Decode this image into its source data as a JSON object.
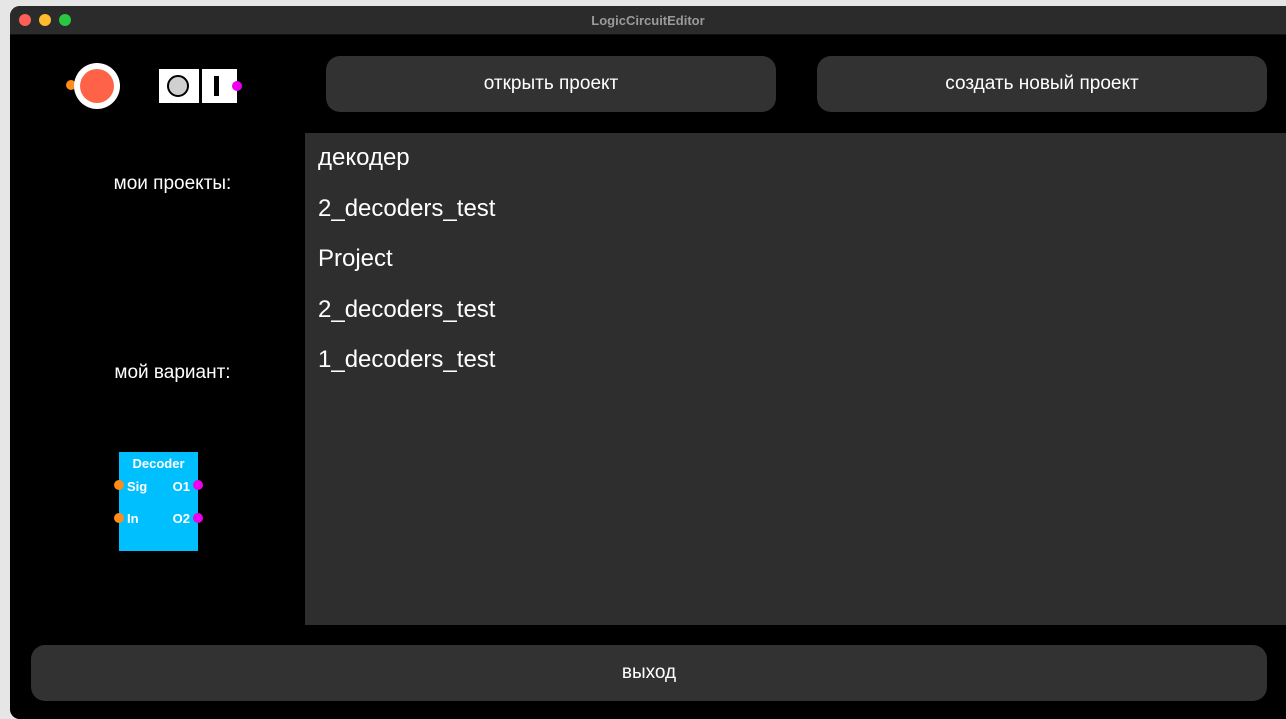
{
  "window": {
    "title": "LogicCircuitEditor"
  },
  "buttons": {
    "open_project": "открыть проект",
    "new_project": "создать новый проект",
    "exit": "выход"
  },
  "labels": {
    "my_projects": "мои проекты:",
    "my_variant": "мой вариант:"
  },
  "decoder": {
    "title": "Decoder",
    "inputs": [
      "Sig",
      "In"
    ],
    "outputs": [
      "O1",
      "O2"
    ]
  },
  "projects": [
    "декодер",
    "2_decoders_test",
    "Project",
    "2_decoders_test",
    "1_decoders_test"
  ],
  "colors": {
    "lamp_red": "#ff6347",
    "input_pin": "#ff8c1a",
    "output_pin": "#ee00ee",
    "decoder_body": "#00bfff",
    "button_bg": "#323232",
    "list_bg": "#2e2e2e"
  }
}
